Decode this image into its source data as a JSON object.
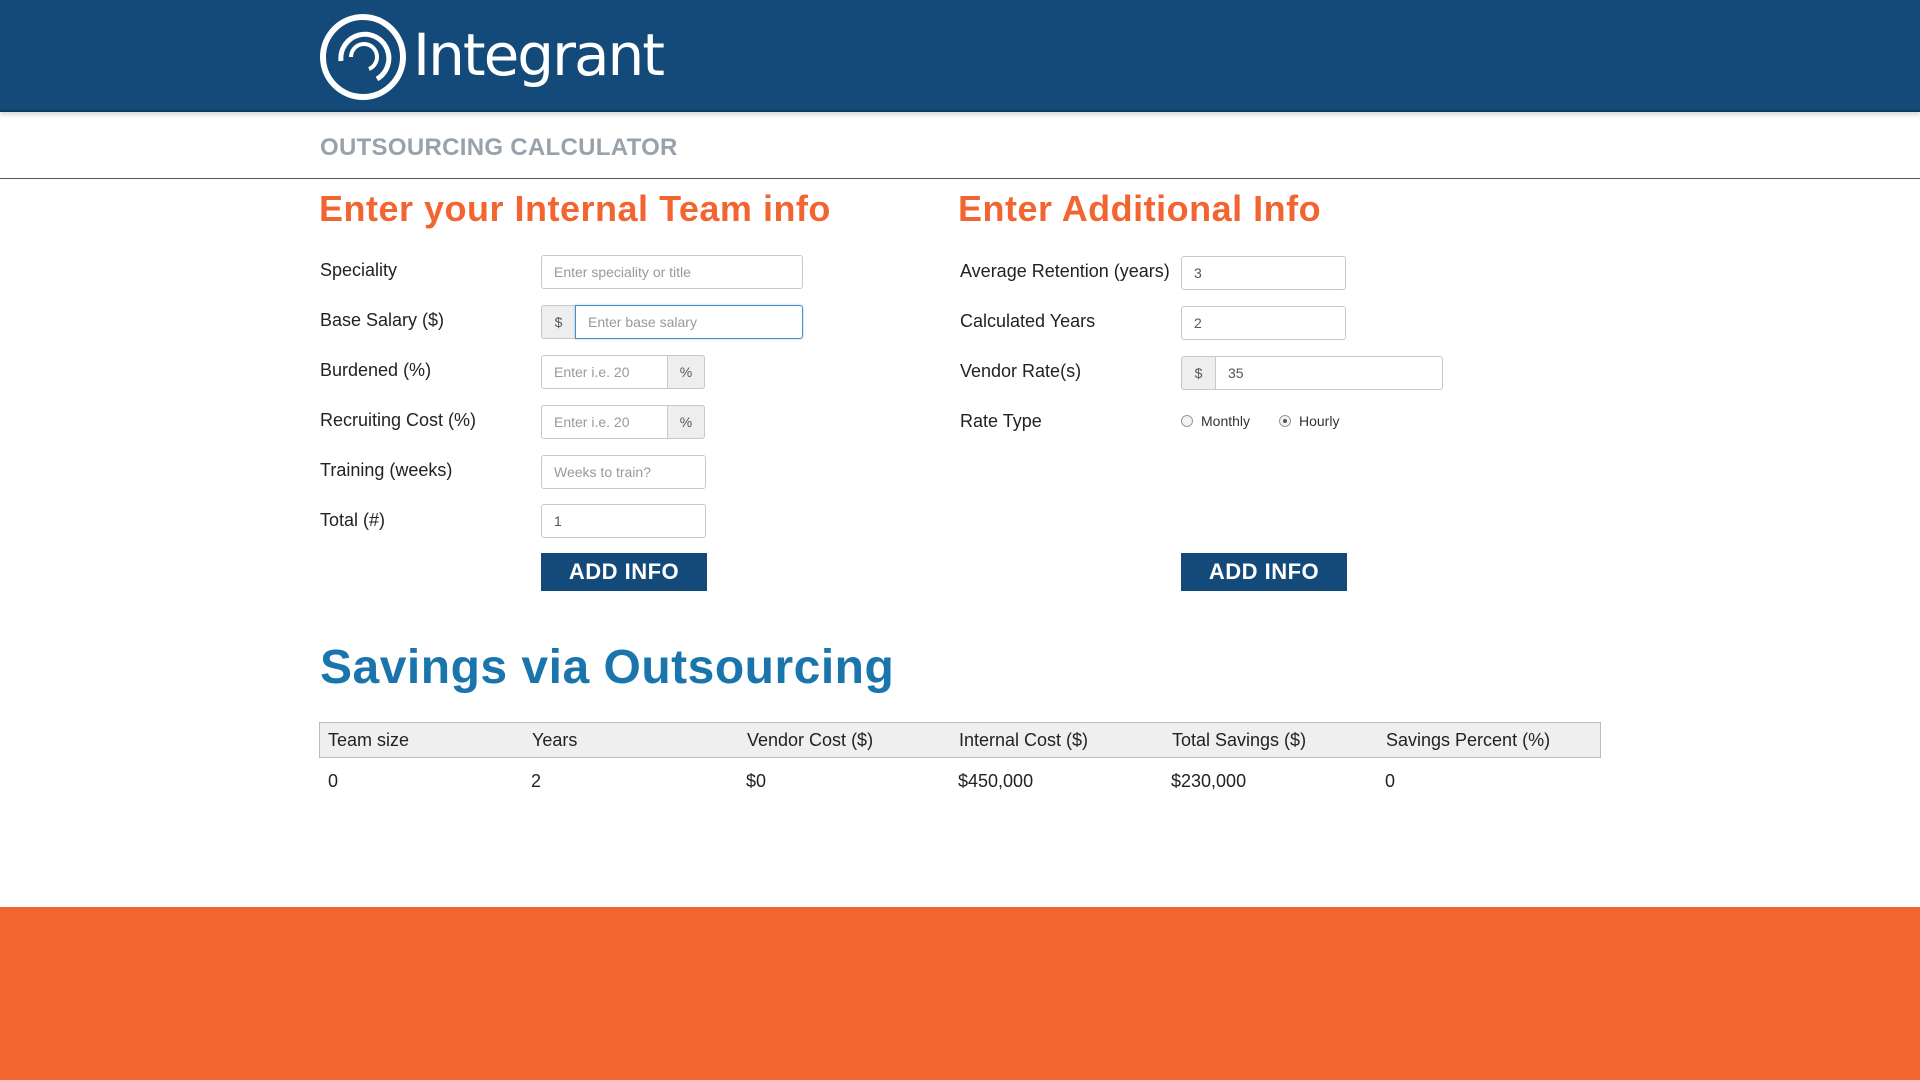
{
  "header": {
    "logo_text": "Integrant",
    "subtitle": "OUTSOURCING CALCULATOR"
  },
  "colors": {
    "brand_blue": "#134a79",
    "accent_orange": "#f26531",
    "heading_blue": "#1b75ad"
  },
  "internal_team": {
    "title": "Enter your Internal Team info",
    "fields": {
      "speciality": {
        "label": "Speciality",
        "placeholder": "Enter speciality or title",
        "value": ""
      },
      "base_salary": {
        "label": "Base Salary ($)",
        "prefix": "$",
        "placeholder": "Enter base salary",
        "value": ""
      },
      "burdened": {
        "label": "Burdened (%)",
        "placeholder": "Enter i.e. 20",
        "suffix": "%",
        "value": ""
      },
      "recruiting_cost": {
        "label": "Recruiting Cost (%)",
        "placeholder": "Enter i.e. 20",
        "suffix": "%",
        "value": ""
      },
      "training": {
        "label": "Training (weeks)",
        "placeholder": "Weeks to train?",
        "value": ""
      },
      "total": {
        "label": "Total (#)",
        "placeholder": "",
        "value": "1"
      }
    },
    "button_label": "ADD INFO"
  },
  "additional_info": {
    "title": "Enter Additional Info",
    "fields": {
      "avg_retention": {
        "label": "Average Retention (years)",
        "value": "3"
      },
      "calculated_years": {
        "label": "Calculated Years",
        "value": "2"
      },
      "vendor_rate": {
        "label": "Vendor Rate(s)",
        "prefix": "$",
        "value": "35"
      },
      "rate_type": {
        "label": "Rate Type",
        "options": [
          "Monthly",
          "Hourly"
        ],
        "selected": "Hourly"
      }
    },
    "button_label": "ADD INFO"
  },
  "savings": {
    "title": "Savings via Outsourcing",
    "columns": [
      "Team size",
      "Years",
      "Vendor Cost ($)",
      "Internal Cost ($)",
      "Total Savings ($)",
      "Savings Percent (%)"
    ],
    "rows": [
      [
        "0",
        "2",
        "$0",
        "$450,000",
        "$230,000",
        "0"
      ]
    ]
  }
}
